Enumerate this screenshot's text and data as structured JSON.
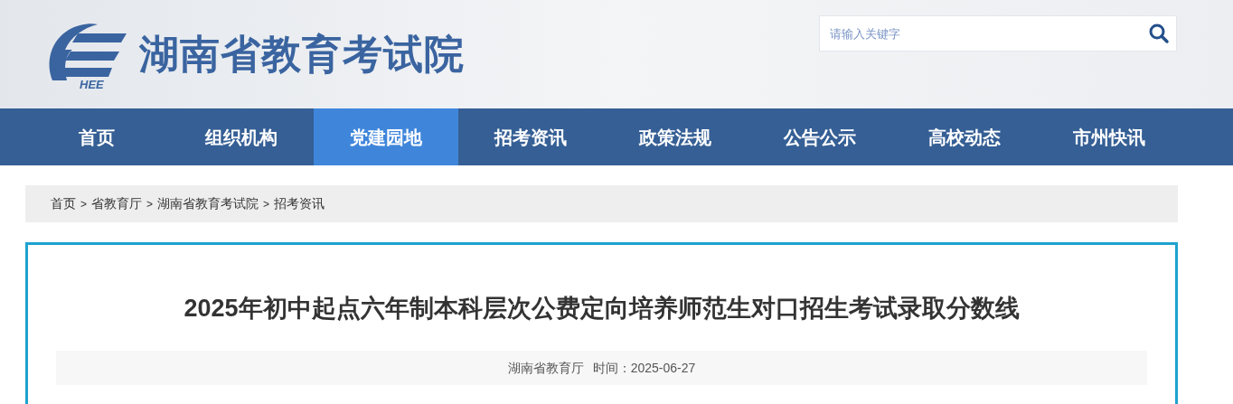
{
  "header": {
    "logo_mark": "HEE",
    "site_name": "湖南省教育考试院",
    "search": {
      "placeholder": "请输入关键字"
    }
  },
  "nav": [
    {
      "label": "首页",
      "selected": false
    },
    {
      "label": "组织机构",
      "selected": false
    },
    {
      "label": "党建园地",
      "selected": true
    },
    {
      "label": "招考资讯",
      "selected": false
    },
    {
      "label": "政策法规",
      "selected": false
    },
    {
      "label": "公告公示",
      "selected": false
    },
    {
      "label": "高校动态",
      "selected": false
    },
    {
      "label": "市州快讯",
      "selected": false
    }
  ],
  "breadcrumb": [
    "首页",
    "省教育厅",
    "湖南省教育考试院",
    "招考资讯"
  ],
  "breadcrumb_separator": ">",
  "article": {
    "title": "2025年初中起点六年制本科层次公费定向培养师范生对口招生考试录取分数线",
    "source": "湖南省教育厅",
    "time": "时间：2025-06-27"
  }
}
